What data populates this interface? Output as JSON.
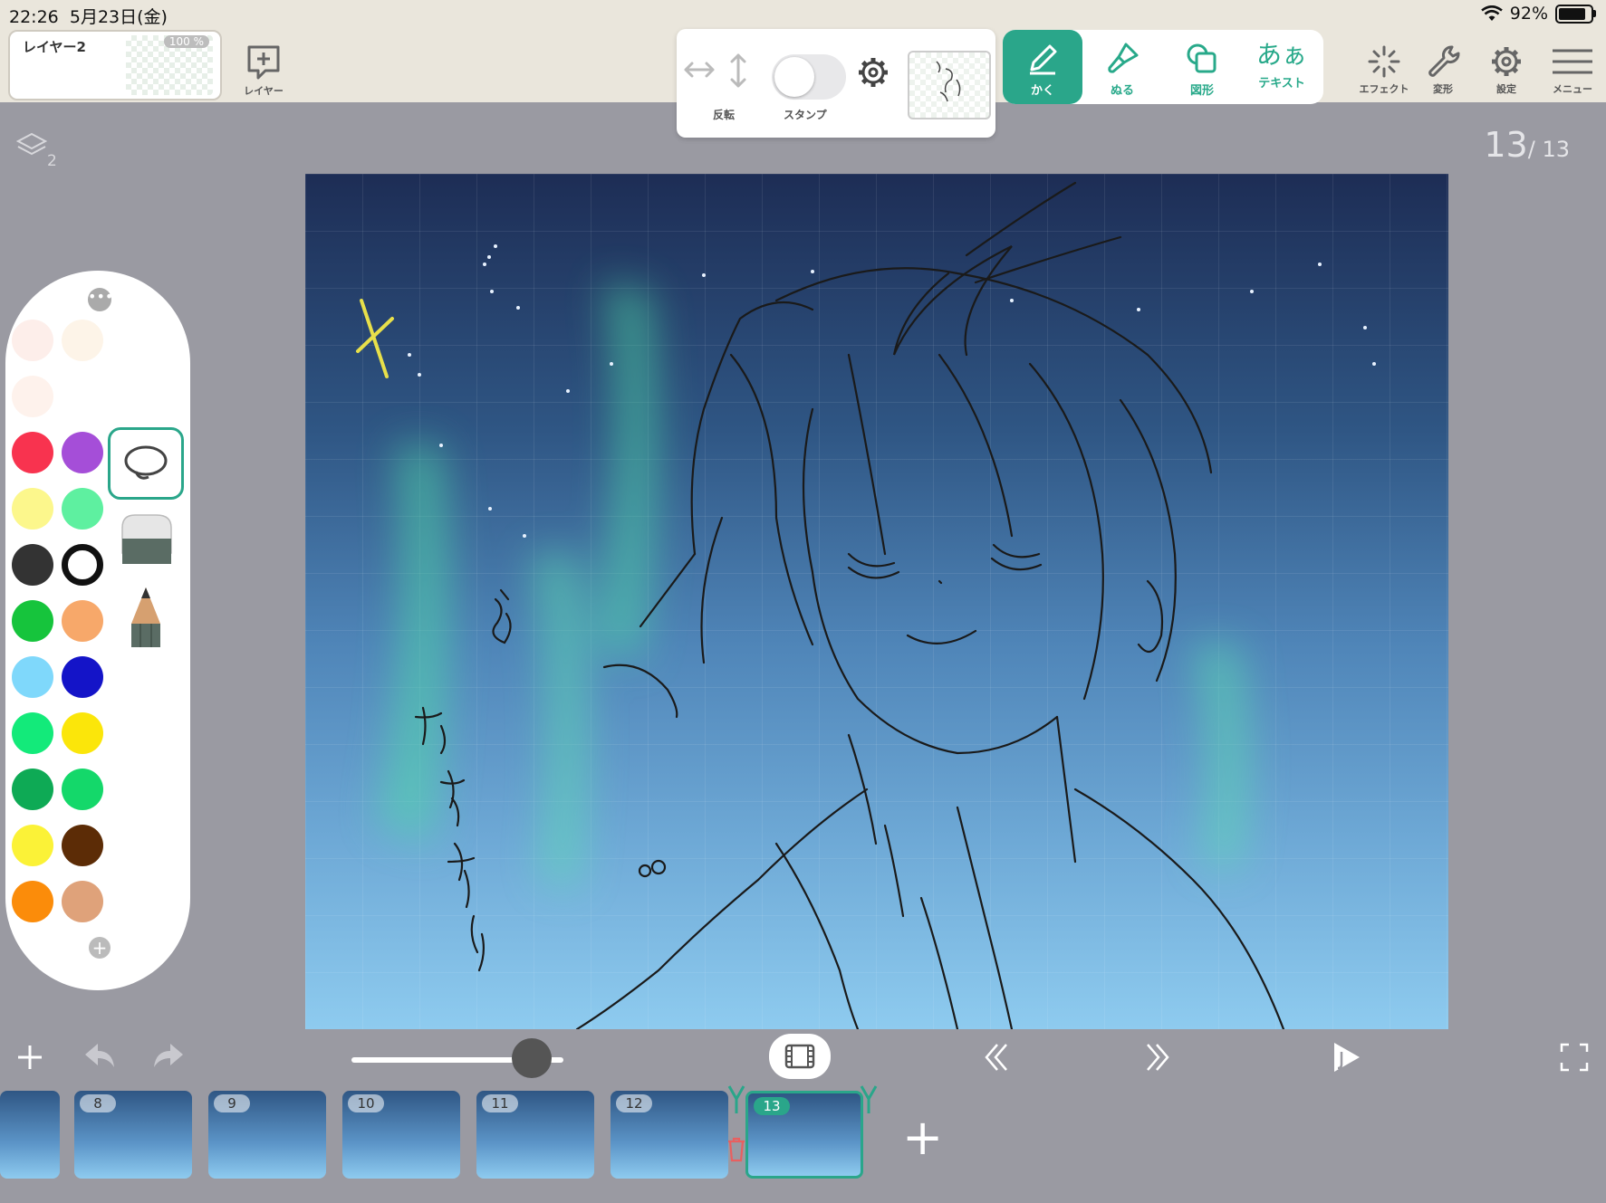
{
  "status": {
    "time": "22:26",
    "date": "5月23日(金)",
    "battery": "92%",
    "battery_level": 0.92
  },
  "layer_card": {
    "name": "レイヤー2",
    "opacity": "100 %"
  },
  "toolbar": {
    "add_layer_label": "レイヤー",
    "flip_label": "反転",
    "stamp_label": "スタンプ",
    "modes": [
      {
        "label": "かく",
        "active": true
      },
      {
        "label": "ぬる",
        "active": false
      },
      {
        "label": "図形",
        "active": false
      },
      {
        "label": "テキスト",
        "glyph": "あぁ",
        "active": false
      }
    ],
    "effect_label": "エフェクト",
    "transform_label": "変形",
    "settings_label": "設定",
    "menu_label": "メニュー"
  },
  "canvas": {
    "layer_count": "2",
    "frame_current": "13",
    "frame_total": "/ 13"
  },
  "palette": {
    "colors": [
      [
        "#fbe3dc",
        "#fcecd9"
      ],
      [
        "#fde9e0",
        "#ffffff"
      ],
      [
        "#f8334f",
        "#a54ed8"
      ],
      [
        "#fcf78c",
        "#5ef0a0"
      ],
      [
        "#333333",
        "#ffffff"
      ],
      [
        "#16c43c",
        "#f7a86a"
      ],
      [
        "#7fd8fb",
        "#1414c8"
      ],
      [
        "#13ea7a",
        "#fbe60a"
      ],
      [
        "#0eaa55",
        "#14d86a"
      ],
      [
        "#fbf237",
        "#5c2c06"
      ],
      [
        "#fb8c0a",
        "#dfa27a"
      ]
    ],
    "tools": [
      "lasso-tool",
      "eraser-tool",
      "pencil-tool"
    ]
  },
  "timeline": {
    "frames": [
      "8",
      "9",
      "10",
      "11",
      "12",
      "13"
    ],
    "current": "13",
    "onion_position": 0.86
  }
}
